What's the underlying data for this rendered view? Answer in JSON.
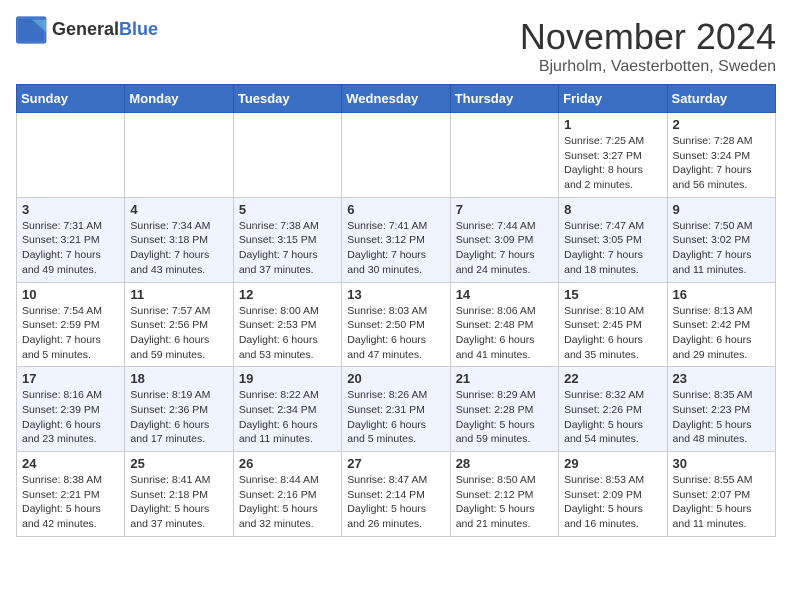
{
  "logo": {
    "general": "General",
    "blue": "Blue"
  },
  "title": "November 2024",
  "location": "Bjurholm, Vaesterbotten, Sweden",
  "days_header": [
    "Sunday",
    "Monday",
    "Tuesday",
    "Wednesday",
    "Thursday",
    "Friday",
    "Saturday"
  ],
  "weeks": [
    [
      {
        "day": "",
        "info": ""
      },
      {
        "day": "",
        "info": ""
      },
      {
        "day": "",
        "info": ""
      },
      {
        "day": "",
        "info": ""
      },
      {
        "day": "",
        "info": ""
      },
      {
        "day": "1",
        "info": "Sunrise: 7:25 AM\nSunset: 3:27 PM\nDaylight: 8 hours and 2 minutes."
      },
      {
        "day": "2",
        "info": "Sunrise: 7:28 AM\nSunset: 3:24 PM\nDaylight: 7 hours and 56 minutes."
      }
    ],
    [
      {
        "day": "3",
        "info": "Sunrise: 7:31 AM\nSunset: 3:21 PM\nDaylight: 7 hours and 49 minutes."
      },
      {
        "day": "4",
        "info": "Sunrise: 7:34 AM\nSunset: 3:18 PM\nDaylight: 7 hours and 43 minutes."
      },
      {
        "day": "5",
        "info": "Sunrise: 7:38 AM\nSunset: 3:15 PM\nDaylight: 7 hours and 37 minutes."
      },
      {
        "day": "6",
        "info": "Sunrise: 7:41 AM\nSunset: 3:12 PM\nDaylight: 7 hours and 30 minutes."
      },
      {
        "day": "7",
        "info": "Sunrise: 7:44 AM\nSunset: 3:09 PM\nDaylight: 7 hours and 24 minutes."
      },
      {
        "day": "8",
        "info": "Sunrise: 7:47 AM\nSunset: 3:05 PM\nDaylight: 7 hours and 18 minutes."
      },
      {
        "day": "9",
        "info": "Sunrise: 7:50 AM\nSunset: 3:02 PM\nDaylight: 7 hours and 11 minutes."
      }
    ],
    [
      {
        "day": "10",
        "info": "Sunrise: 7:54 AM\nSunset: 2:59 PM\nDaylight: 7 hours and 5 minutes."
      },
      {
        "day": "11",
        "info": "Sunrise: 7:57 AM\nSunset: 2:56 PM\nDaylight: 6 hours and 59 minutes."
      },
      {
        "day": "12",
        "info": "Sunrise: 8:00 AM\nSunset: 2:53 PM\nDaylight: 6 hours and 53 minutes."
      },
      {
        "day": "13",
        "info": "Sunrise: 8:03 AM\nSunset: 2:50 PM\nDaylight: 6 hours and 47 minutes."
      },
      {
        "day": "14",
        "info": "Sunrise: 8:06 AM\nSunset: 2:48 PM\nDaylight: 6 hours and 41 minutes."
      },
      {
        "day": "15",
        "info": "Sunrise: 8:10 AM\nSunset: 2:45 PM\nDaylight: 6 hours and 35 minutes."
      },
      {
        "day": "16",
        "info": "Sunrise: 8:13 AM\nSunset: 2:42 PM\nDaylight: 6 hours and 29 minutes."
      }
    ],
    [
      {
        "day": "17",
        "info": "Sunrise: 8:16 AM\nSunset: 2:39 PM\nDaylight: 6 hours and 23 minutes."
      },
      {
        "day": "18",
        "info": "Sunrise: 8:19 AM\nSunset: 2:36 PM\nDaylight: 6 hours and 17 minutes."
      },
      {
        "day": "19",
        "info": "Sunrise: 8:22 AM\nSunset: 2:34 PM\nDaylight: 6 hours and 11 minutes."
      },
      {
        "day": "20",
        "info": "Sunrise: 8:26 AM\nSunset: 2:31 PM\nDaylight: 6 hours and 5 minutes."
      },
      {
        "day": "21",
        "info": "Sunrise: 8:29 AM\nSunset: 2:28 PM\nDaylight: 5 hours and 59 minutes."
      },
      {
        "day": "22",
        "info": "Sunrise: 8:32 AM\nSunset: 2:26 PM\nDaylight: 5 hours and 54 minutes."
      },
      {
        "day": "23",
        "info": "Sunrise: 8:35 AM\nSunset: 2:23 PM\nDaylight: 5 hours and 48 minutes."
      }
    ],
    [
      {
        "day": "24",
        "info": "Sunrise: 8:38 AM\nSunset: 2:21 PM\nDaylight: 5 hours and 42 minutes."
      },
      {
        "day": "25",
        "info": "Sunrise: 8:41 AM\nSunset: 2:18 PM\nDaylight: 5 hours and 37 minutes."
      },
      {
        "day": "26",
        "info": "Sunrise: 8:44 AM\nSunset: 2:16 PM\nDaylight: 5 hours and 32 minutes."
      },
      {
        "day": "27",
        "info": "Sunrise: 8:47 AM\nSunset: 2:14 PM\nDaylight: 5 hours and 26 minutes."
      },
      {
        "day": "28",
        "info": "Sunrise: 8:50 AM\nSunset: 2:12 PM\nDaylight: 5 hours and 21 minutes."
      },
      {
        "day": "29",
        "info": "Sunrise: 8:53 AM\nSunset: 2:09 PM\nDaylight: 5 hours and 16 minutes."
      },
      {
        "day": "30",
        "info": "Sunrise: 8:55 AM\nSunset: 2:07 PM\nDaylight: 5 hours and 11 minutes."
      }
    ]
  ]
}
